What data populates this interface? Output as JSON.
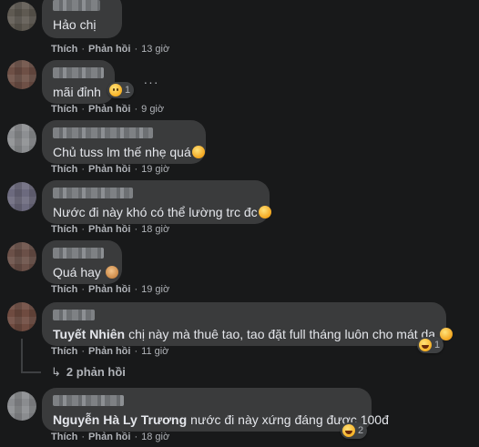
{
  "actions": {
    "like": "Thích",
    "reply": "Phản hồi",
    "more": "···"
  },
  "colors": {
    "background": "#18191a",
    "bubble": "#3a3b3c",
    "text": "#e4e6eb",
    "meta": "#b0b3b8"
  },
  "comments": [
    {
      "text": "Hảo chị",
      "time": "13 giờ"
    },
    {
      "text": "mãi đỉnh",
      "time": "9 giờ",
      "reaction_count": "1",
      "reaction_icon": "sad-emoji"
    },
    {
      "text": "Chủ tuss lm thế nhẹ quá",
      "time": "19 giờ"
    },
    {
      "text": "Nước đi này khó có thể lường trc đc",
      "time": "18 giờ"
    },
    {
      "text": "Quá hay",
      "time": "19 giờ"
    },
    {
      "author": "Tuyết Nhiên",
      "text": "chị này mà thuê tao, tao đặt full tháng luôn cho mát dạ",
      "time": "11 giờ",
      "reaction_count": "1",
      "reaction_icon": "laughing-emoji",
      "replies": "2 phản hồi"
    },
    {
      "author": "Nguyễn Hà Ly Trương",
      "text": "nước đi này xứng đáng được 100đ",
      "time": "18 giờ",
      "reaction_count": "2",
      "reaction_icon": "laughing-emoji"
    }
  ]
}
